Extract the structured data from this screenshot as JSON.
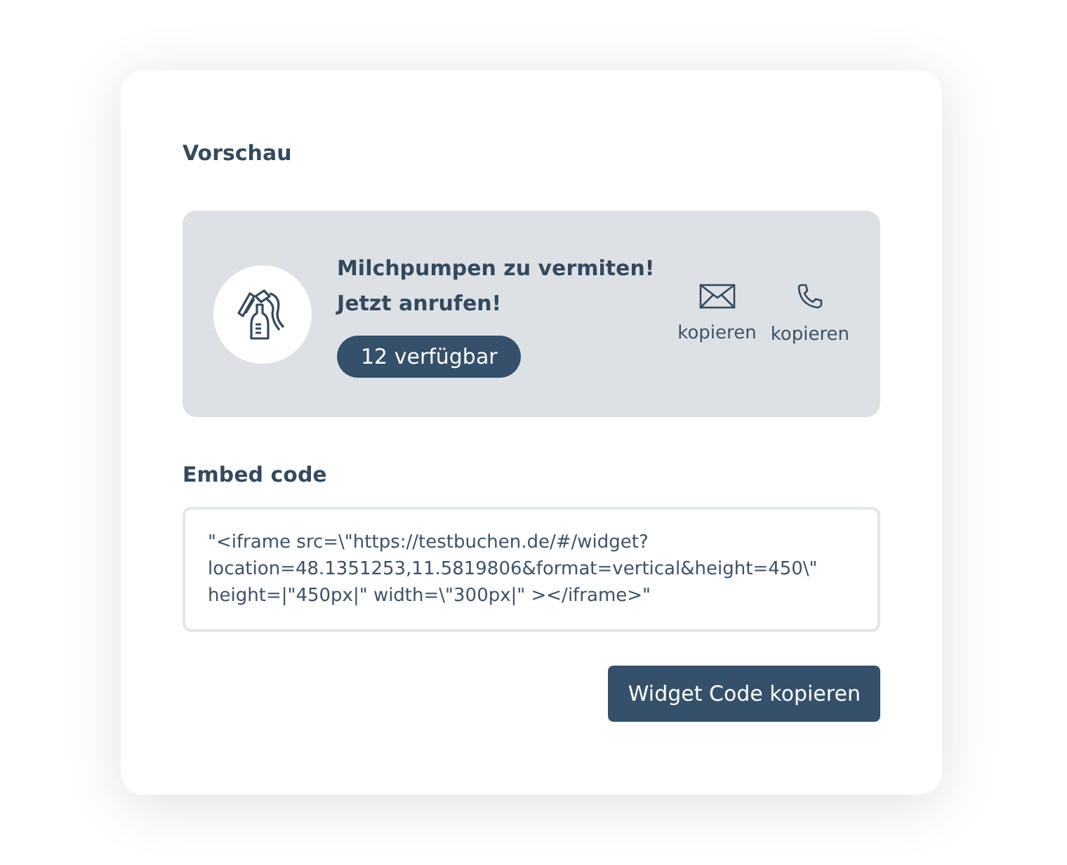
{
  "preview": {
    "heading": "Vorschau",
    "title_lines": [
      "Milchpumpen zu vermiten!",
      "Jetzt anrufen!"
    ],
    "badge": "12 verfügbar",
    "actions": [
      {
        "kind": "email",
        "label": "kopieren"
      },
      {
        "kind": "phone",
        "label": "kopieren"
      }
    ]
  },
  "embed": {
    "heading": "Embed code",
    "code_lines": [
      "\"<iframe src=\\\"https://testbuchen.de/#/widget?",
      "location=48.1351253,11.5819806&format=vertical&height=450\\\"",
      "height=|\"450px|\" width=\\\"300px|\" ></iframe>\""
    ],
    "button": "Widget Code kopieren"
  }
}
